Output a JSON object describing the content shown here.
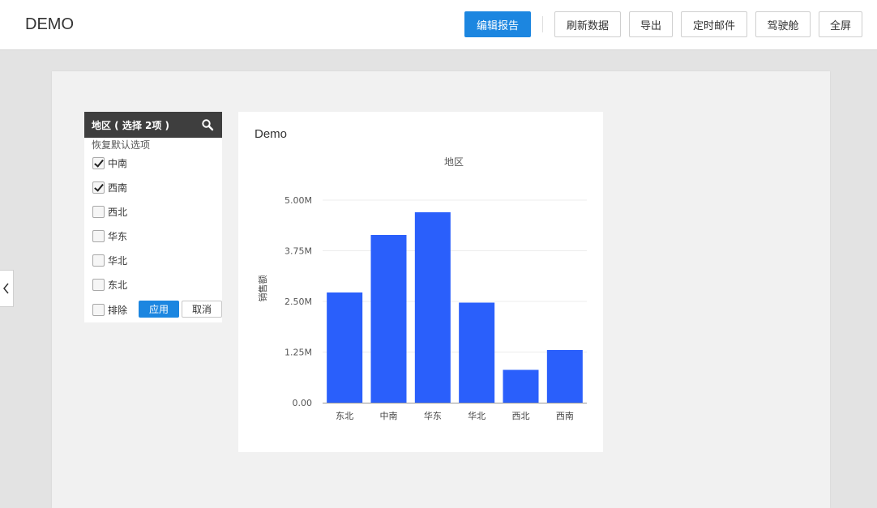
{
  "app": {
    "title": "DEMO"
  },
  "toolbar": {
    "edit_report": "编辑报告",
    "refresh": "刷新数据",
    "export": "导出",
    "schedule_mail": "定时邮件",
    "cockpit": "驾驶舱",
    "fullscreen": "全屏"
  },
  "filter": {
    "header": "地区 ( 选择 2项 )",
    "reset": "恢复默认选项",
    "options": [
      {
        "label": "中南",
        "checked": true
      },
      {
        "label": "西南",
        "checked": true
      },
      {
        "label": "西北",
        "checked": false
      },
      {
        "label": "华东",
        "checked": false
      },
      {
        "label": "华北",
        "checked": false
      },
      {
        "label": "东北",
        "checked": false
      }
    ],
    "exclude": "排除",
    "apply": "应用",
    "cancel": "取消",
    "icons": {
      "search": "search-icon",
      "collapse": "chevron-left-icon"
    }
  },
  "chart": {
    "card_title": "Demo"
  },
  "chart_data": {
    "type": "bar",
    "title": "地区",
    "xlabel": "",
    "ylabel": "销售额",
    "categories": [
      "东北",
      "中南",
      "华东",
      "华北",
      "西北",
      "西南"
    ],
    "values": [
      2.72,
      4.14,
      4.7,
      2.47,
      0.81,
      1.3
    ],
    "value_unit": "M",
    "ylim": [
      0,
      5
    ],
    "yticks": [
      "0.00",
      "1.25M",
      "2.50M",
      "3.75M",
      "5.00M"
    ],
    "ytick_values": [
      0,
      1.25,
      2.5,
      3.75,
      5
    ],
    "bar_color": "#2a5ffb",
    "grid": true
  }
}
